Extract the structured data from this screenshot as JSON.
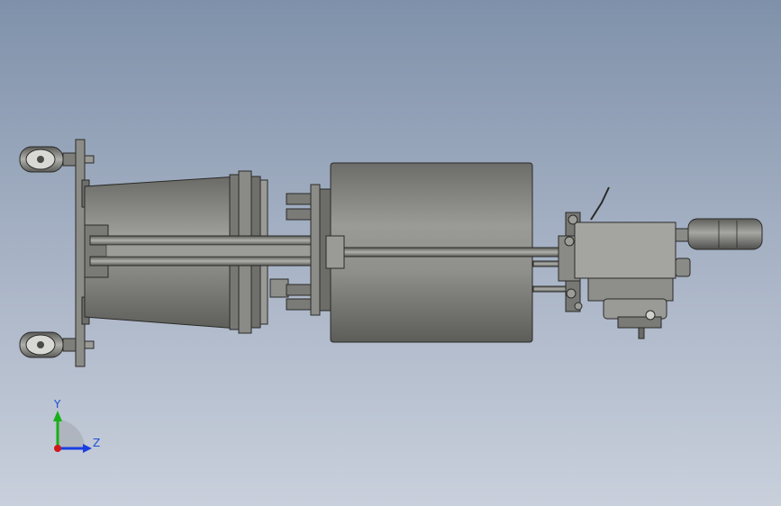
{
  "triad": {
    "y_label": "Y",
    "z_label": "Z",
    "y_color": "#18b018",
    "z_color": "#1a3fe0",
    "origin_color": "#d01818"
  },
  "colors": {
    "background_top": "#7f91aa",
    "background_bottom": "#c9d0dc",
    "metal": "#8a8a86",
    "metal_dark": "#3a3a38"
  }
}
